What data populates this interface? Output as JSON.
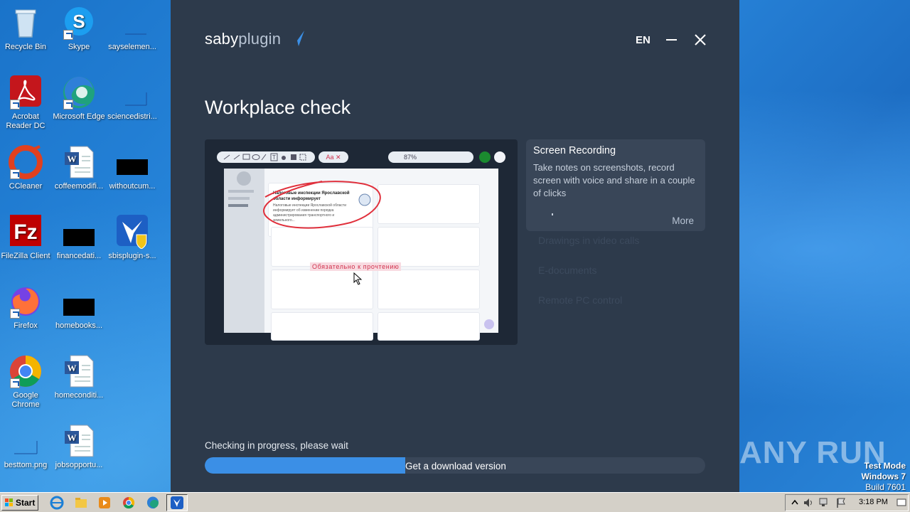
{
  "desktop": {
    "icons": [
      {
        "label": "Recycle Bin"
      },
      {
        "label": "Skype"
      },
      {
        "label": "sayselemen..."
      },
      {
        "label": "Acrobat Reader DC"
      },
      {
        "label": "Microsoft Edge"
      },
      {
        "label": "sciencedistri..."
      },
      {
        "label": "CCleaner"
      },
      {
        "label": "coffeemodifi..."
      },
      {
        "label": "withoutcum..."
      },
      {
        "label": "FileZilla Client"
      },
      {
        "label": "financedati..."
      },
      {
        "label": "sbisplugin-s..."
      },
      {
        "label": "Firefox"
      },
      {
        "label": "homebooks..."
      },
      {
        "label": "Google Chrome"
      },
      {
        "label": "homeconditi..."
      },
      {
        "label": "besttom.png"
      },
      {
        "label": "jobsopportu..."
      }
    ]
  },
  "app": {
    "logo_saby": "saby",
    "logo_plugin": "plugin",
    "language": "EN",
    "title": "Workplace check",
    "preview": {
      "zoom": "87%",
      "red_tool": "Aa",
      "card_title": "Налоговые инспекции Ярославской области информирует",
      "card_body": "Налоговые инспекции Ярославской области информирует об изменении порядка администрирования транспортного и земельного...",
      "note": "Обязательно к прочтению"
    },
    "feature": {
      "title": "Screen Recording",
      "description": "Take notes on screenshots, record screen with voice and share in a couple of clicks",
      "more_label": "More"
    },
    "feature_list": [
      "Drawings in video calls",
      "E-documents",
      "Remote PC control"
    ],
    "status_text": "Checking in progress, please wait",
    "progress_percent": 40,
    "download_label": "Get a download version"
  },
  "watermark": {
    "brand": "ANY RUN",
    "test_mode": "Test Mode",
    "os": "Windows 7",
    "build": "Build 7601"
  },
  "taskbar": {
    "start_label": "Start",
    "clock": "3:18 PM"
  }
}
